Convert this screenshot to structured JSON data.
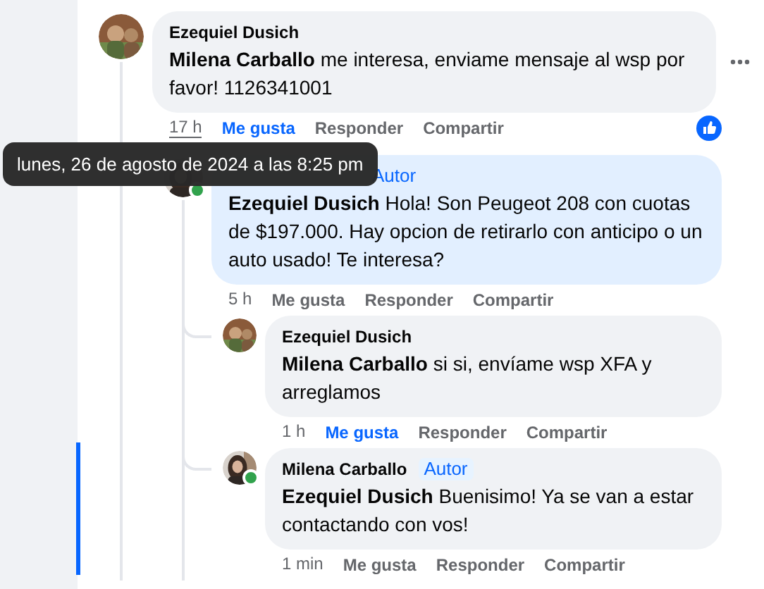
{
  "comments": [
    {
      "author": "Ezequiel Dusich",
      "highlighted": false,
      "mention": "Milena Carballo",
      "text": "me interesa, enviame mensaje al wsp por favor! 1126341001",
      "time": "17 h",
      "time_hovered": true,
      "like_label": "Me gusta",
      "liked": true,
      "reply_label": "Responder",
      "share_label": "Compartir",
      "more_button": true,
      "reactions": [
        {
          "kind": "like"
        }
      ],
      "children": [
        {
          "online": true,
          "highlighted": true,
          "badge": "Autor",
          "mention": "Ezequiel Dusich",
          "text": "Hola! Son Peugeot 208 con cuotas de $197.000. Hay opcion de retirarlo con anticipo o un auto usado! Te interesa?",
          "time": "5 h",
          "time_hovered": false,
          "like_label": "Me gusta",
          "liked": false,
          "reply_label": "Responder",
          "share_label": "Compartir",
          "children": [
            {
              "author": "Ezequiel Dusich",
              "highlighted": false,
              "mention": "Milena Carballo",
              "text": "si si, envíame wsp XFA y arreglamos",
              "time": "1 h",
              "time_hovered": false,
              "like_label": "Me gusta",
              "liked": true,
              "reply_label": "Responder",
              "share_label": "Compartir"
            },
            {
              "author": "Milena Carballo",
              "online": true,
              "highlighted": false,
              "badge": "Autor",
              "mention": "Ezequiel Dusich",
              "text": "Buenisimo! Ya se van a estar contactando con vos!",
              "time": "1 min",
              "time_hovered": false,
              "like_label": "Me gusta",
              "liked": false,
              "reply_label": "Responder",
              "share_label": "Compartir"
            }
          ]
        }
      ]
    }
  ],
  "tooltip": {
    "text": "lunes, 26 de agosto de 2024 a las 8:25 pm"
  }
}
